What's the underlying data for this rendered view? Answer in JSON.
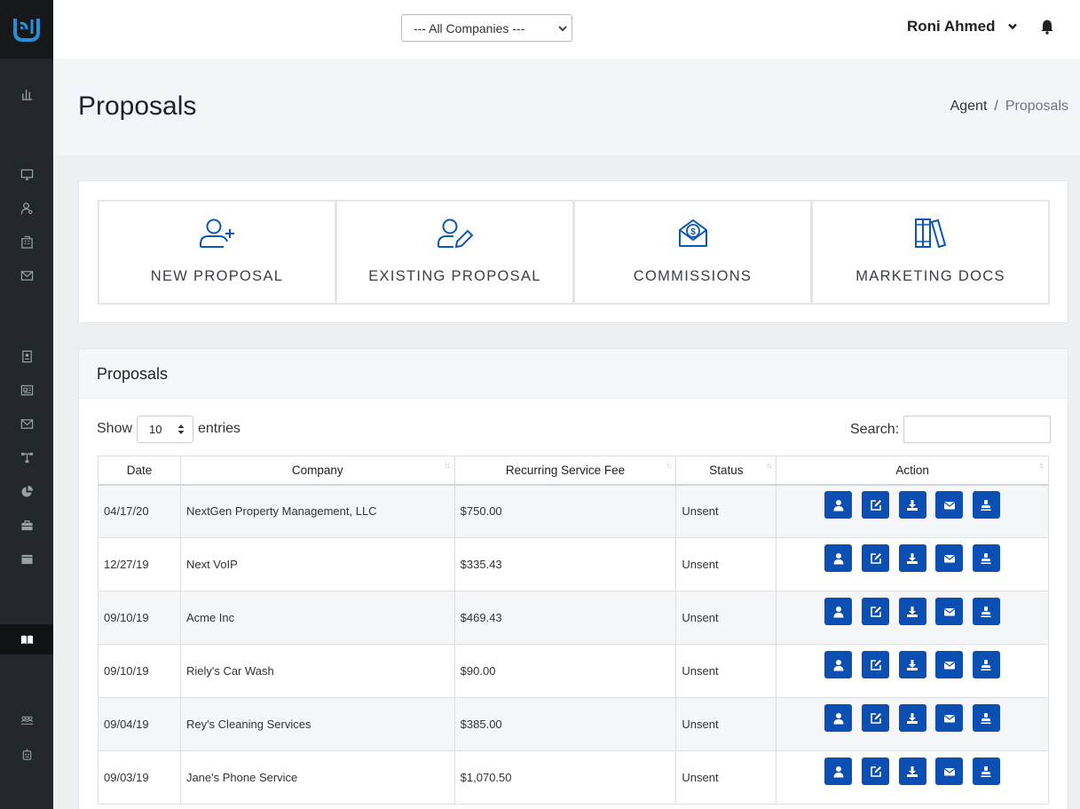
{
  "header": {
    "company_filter": "--- All Companies ---",
    "user_name": "Roni Ahmed"
  },
  "page": {
    "title": "Proposals",
    "breadcrumb": {
      "parent": "Agent",
      "separator": "/",
      "current": "Proposals"
    }
  },
  "tiles": [
    {
      "label": "NEW PROPOSAL",
      "icon": "user-plus-icon"
    },
    {
      "label": "EXISTING PROPOSAL",
      "icon": "user-edit-icon"
    },
    {
      "label": "COMMISSIONS",
      "icon": "money-envelope-icon"
    },
    {
      "label": "MARKETING DOCS",
      "icon": "books-icon"
    }
  ],
  "table_card": {
    "title": "Proposals",
    "show_label": "Show",
    "entries_value": "10",
    "entries_label": "entries",
    "search_label": "Search:",
    "search_value": "",
    "columns": [
      "Date",
      "Company",
      "Recurring Service Fee",
      "Status",
      "Action"
    ],
    "rows": [
      {
        "date": "04/17/20",
        "company": "NextGen Property Management, LLC",
        "fee": "$750.00",
        "status": "Unsent"
      },
      {
        "date": "12/27/19",
        "company": "Next VoIP",
        "fee": "$335.43",
        "status": "Unsent"
      },
      {
        "date": "09/10/19",
        "company": "Acme Inc",
        "fee": "$469.43",
        "status": "Unsent"
      },
      {
        "date": "09/10/19",
        "company": "Riely's Car Wash",
        "fee": "$90.00",
        "status": "Unsent"
      },
      {
        "date": "09/04/19",
        "company": "Rey's Cleaning Services",
        "fee": "$385.00",
        "status": "Unsent"
      },
      {
        "date": "09/03/19",
        "company": "Jane's Phone Service",
        "fee": "$1,070.50",
        "status": "Unsent"
      }
    ],
    "action_icons": [
      "user-icon",
      "edit-icon",
      "download-icon",
      "envelope-icon",
      "stamp-icon"
    ]
  },
  "sidebar": {
    "icons": [
      "chart-icon",
      "monitor-icon",
      "user-search-icon",
      "building-icon",
      "mail-icon",
      "contact-card-icon",
      "newspaper-icon",
      "envelope-icon",
      "sitemap-icon",
      "pie-chart-icon",
      "toolbox-icon",
      "wallet-icon",
      "book-open-icon",
      "users-icon",
      "robot-icon"
    ]
  },
  "colors": {
    "sidebar": "#23272b",
    "accent": "#0b4fb3",
    "tile_icon": "#0b57b8"
  }
}
